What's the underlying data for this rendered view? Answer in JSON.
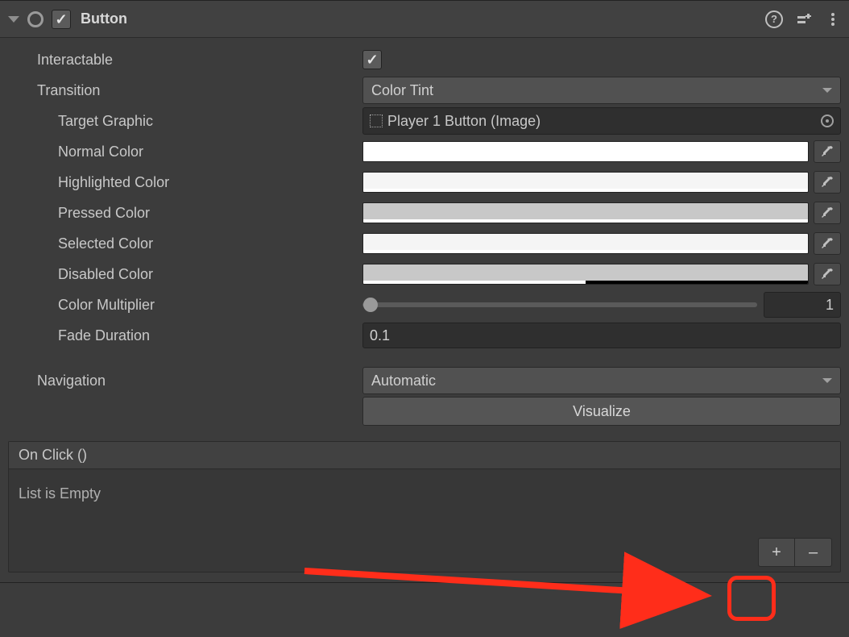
{
  "component": {
    "title": "Button",
    "enabled": true
  },
  "fields": {
    "interactable_label": "Interactable",
    "interactable_checked": true,
    "transition_label": "Transition",
    "transition_value": "Color Tint",
    "target_graphic_label": "Target Graphic",
    "target_graphic_value": "Player 1 Button (Image)",
    "normal_color_label": "Normal Color",
    "normal_color": {
      "hex": "#ffffff",
      "alpha": 1.0
    },
    "highlighted_color_label": "Highlighted Color",
    "highlighted_color": {
      "hex": "#f5f5f5",
      "alpha": 1.0
    },
    "pressed_color_label": "Pressed Color",
    "pressed_color": {
      "hex": "#c8c8c8",
      "alpha": 1.0
    },
    "selected_color_label": "Selected Color",
    "selected_color": {
      "hex": "#f5f5f5",
      "alpha": 1.0
    },
    "disabled_color_label": "Disabled Color",
    "disabled_color": {
      "hex": "#c8c8c8",
      "alpha": 0.5
    },
    "color_multiplier_label": "Color Multiplier",
    "color_multiplier_value": "1",
    "fade_duration_label": "Fade Duration",
    "fade_duration_value": "0.1",
    "navigation_label": "Navigation",
    "navigation_value": "Automatic",
    "visualize_label": "Visualize"
  },
  "events": {
    "title": "On Click ()",
    "empty_text": "List is Empty",
    "add_label": "+",
    "remove_label": "–"
  }
}
